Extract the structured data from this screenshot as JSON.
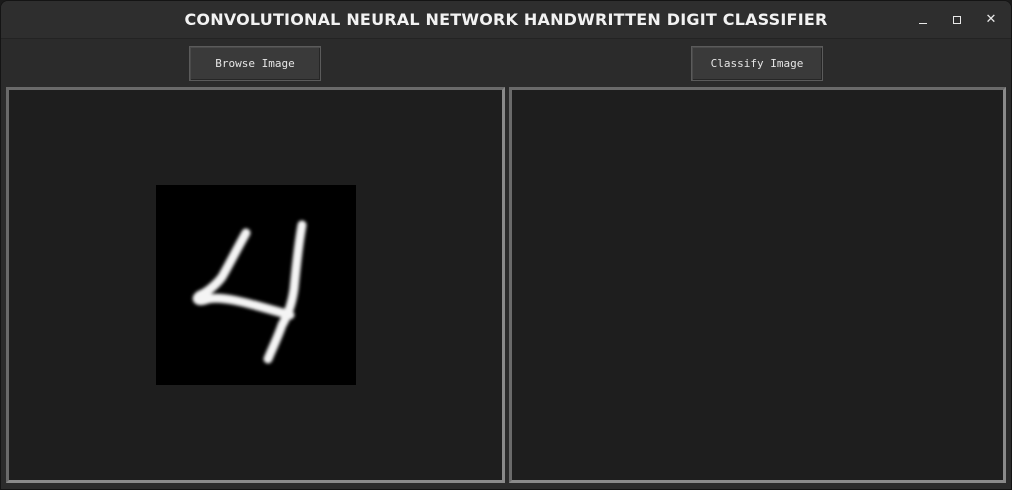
{
  "window": {
    "title": "CONVOLUTIONAL NEURAL NETWORK HANDWRITTEN DIGIT CLASSIFIER",
    "controls": {
      "minimize_icon": "minimize-icon",
      "maximize_icon": "maximize-icon",
      "close_icon": "close-icon",
      "close_glyph": "✕"
    }
  },
  "toolbar": {
    "browse_label": "Browse Image",
    "classify_label": "Classify Image"
  },
  "left_panel": {
    "image": {
      "description_icon": "handwritten-digit-image",
      "background": "#000000",
      "stroke_color": "#ffffff"
    }
  },
  "right_panel": {
    "result": ""
  },
  "colors": {
    "window_bg": "#2b2b2b",
    "panel_bg": "#1e1e1e",
    "panel_border": "#6a6a6a",
    "button_bg": "#3a3a3a",
    "text": "#f2f2f2"
  }
}
